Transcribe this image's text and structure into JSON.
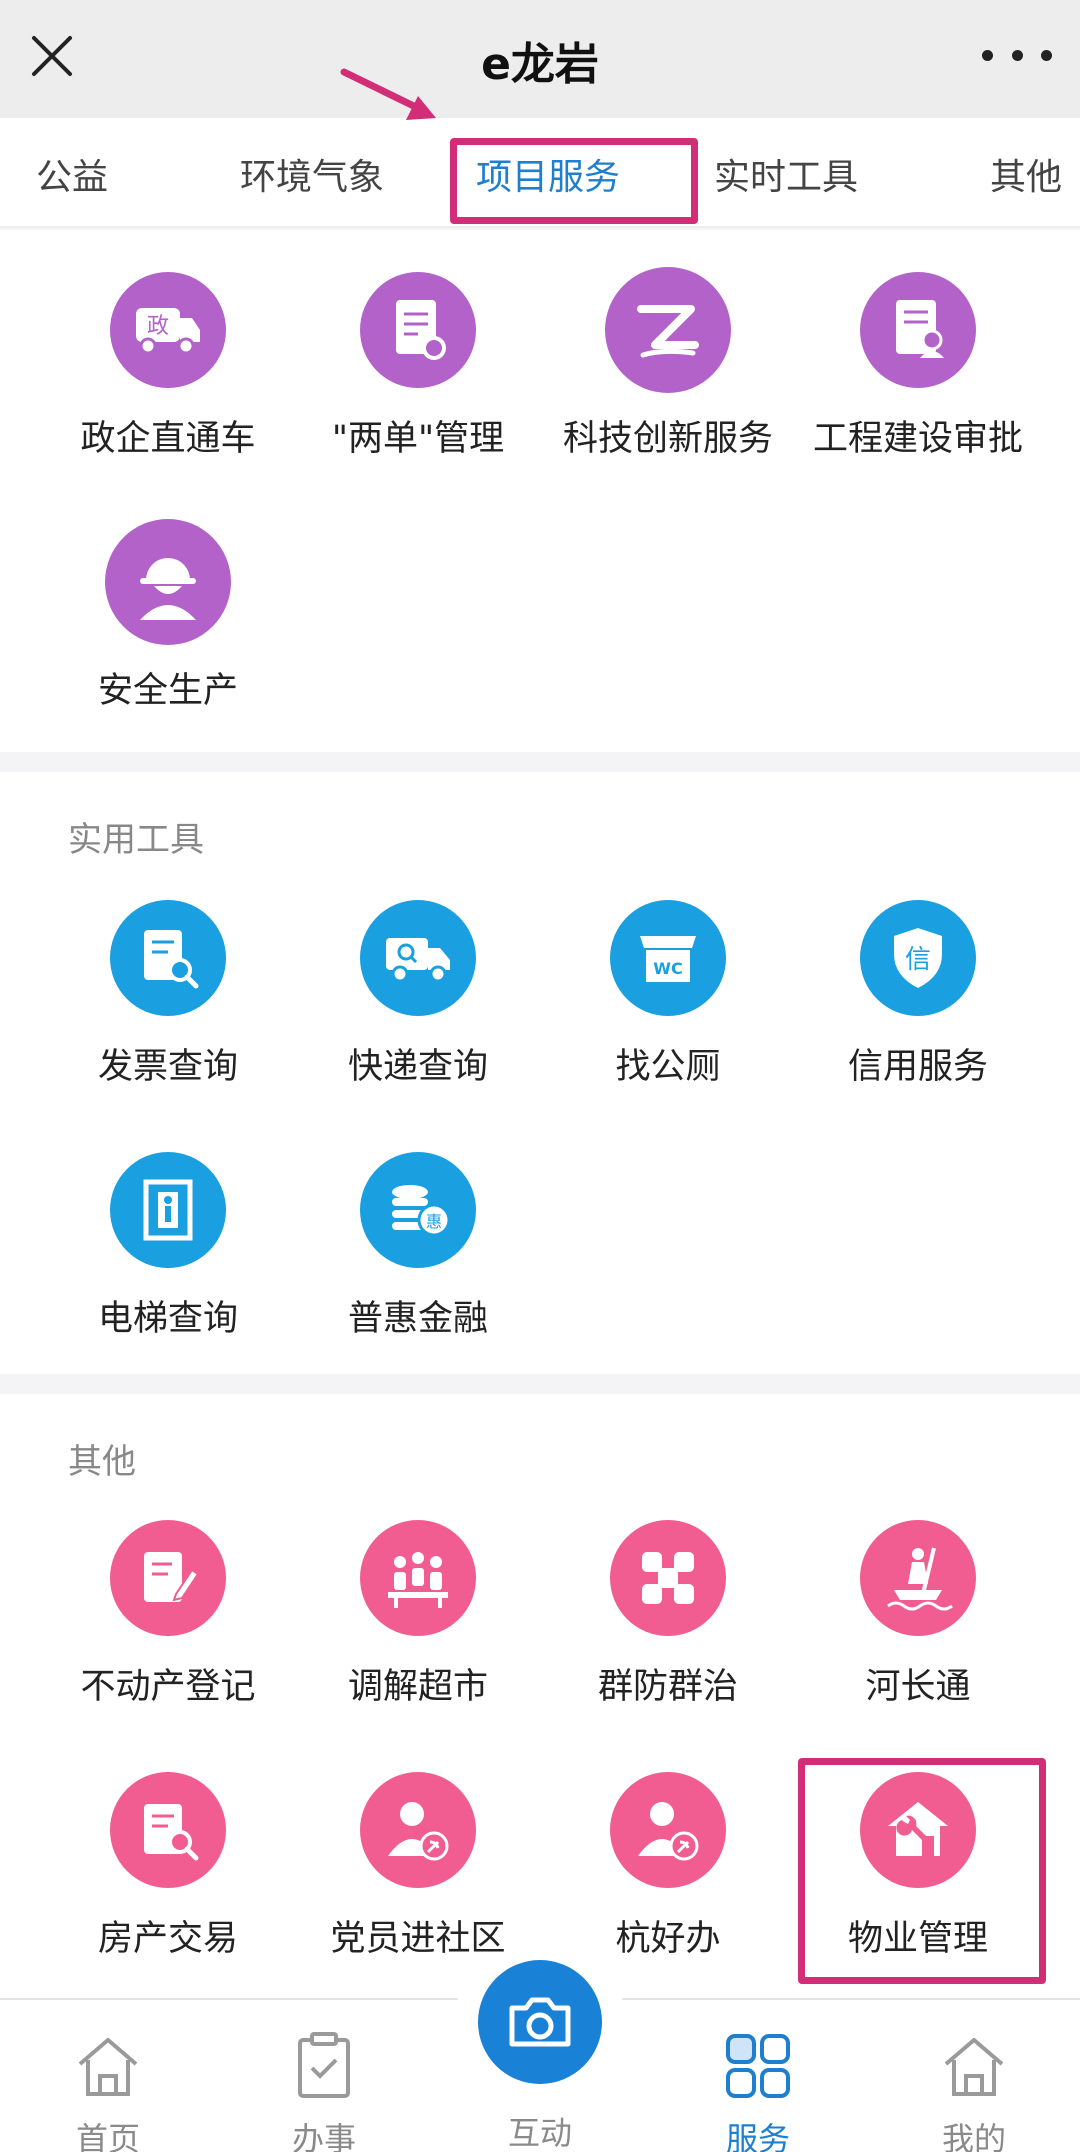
{
  "app": {
    "title": "e龙岩"
  },
  "tabs": [
    {
      "label": "公益"
    },
    {
      "label": "环境气象"
    },
    {
      "label": "项目服务"
    },
    {
      "label": "实时工具"
    },
    {
      "label": "其他"
    }
  ],
  "project_services": {
    "items": [
      {
        "label": "政企直通车",
        "icon": "government-truck-icon",
        "glyph": "政"
      },
      {
        "label": "\"两单\"管理",
        "icon": "document-gear-icon"
      },
      {
        "label": "科技创新服务",
        "icon": "tech-logo-icon"
      },
      {
        "label": "工程建设审批",
        "icon": "approval-document-icon"
      },
      {
        "label": "安全生产",
        "icon": "worker-helmet-icon"
      }
    ]
  },
  "practical_tools": {
    "title": "实用工具",
    "items": [
      {
        "label": "发票查询",
        "icon": "invoice-search-icon"
      },
      {
        "label": "快递查询",
        "icon": "delivery-truck-icon"
      },
      {
        "label": "找公厕",
        "icon": "wc-store-icon",
        "glyph": "WC"
      },
      {
        "label": "信用服务",
        "icon": "credit-shield-icon",
        "glyph": "信"
      },
      {
        "label": "电梯查询",
        "icon": "elevator-icon"
      },
      {
        "label": "普惠金融",
        "icon": "coin-stack-icon",
        "glyph": "惠"
      }
    ]
  },
  "others": {
    "title": "其他",
    "items": [
      {
        "label": "不动产登记",
        "icon": "notebook-pen-icon"
      },
      {
        "label": "调解超市",
        "icon": "meeting-people-icon"
      },
      {
        "label": "群防群治",
        "icon": "cross-blocks-icon"
      },
      {
        "label": "河长通",
        "icon": "river-patrol-icon"
      },
      {
        "label": "房产交易",
        "icon": "house-document-search-icon"
      },
      {
        "label": "党员进社区",
        "icon": "party-member-icon"
      },
      {
        "label": "杭好办",
        "icon": "party-member-icon"
      },
      {
        "label": "物业管理",
        "icon": "house-wrench-icon"
      }
    ]
  },
  "bottom_nav": [
    {
      "label": "首页",
      "icon": "home-icon"
    },
    {
      "label": "办事",
      "icon": "clipboard-check-icon"
    },
    {
      "label": "互动",
      "icon": "camera-icon"
    },
    {
      "label": "服务",
      "icon": "grid-icon",
      "active": true
    },
    {
      "label": "我的",
      "icon": "home-outline-icon"
    }
  ],
  "colors": {
    "accent": "#1e7fcf",
    "project_icon": "#b262c9",
    "tools_icon": "#1a9fe0",
    "others_icon": "#f25d91",
    "highlight": "#d22e78"
  }
}
